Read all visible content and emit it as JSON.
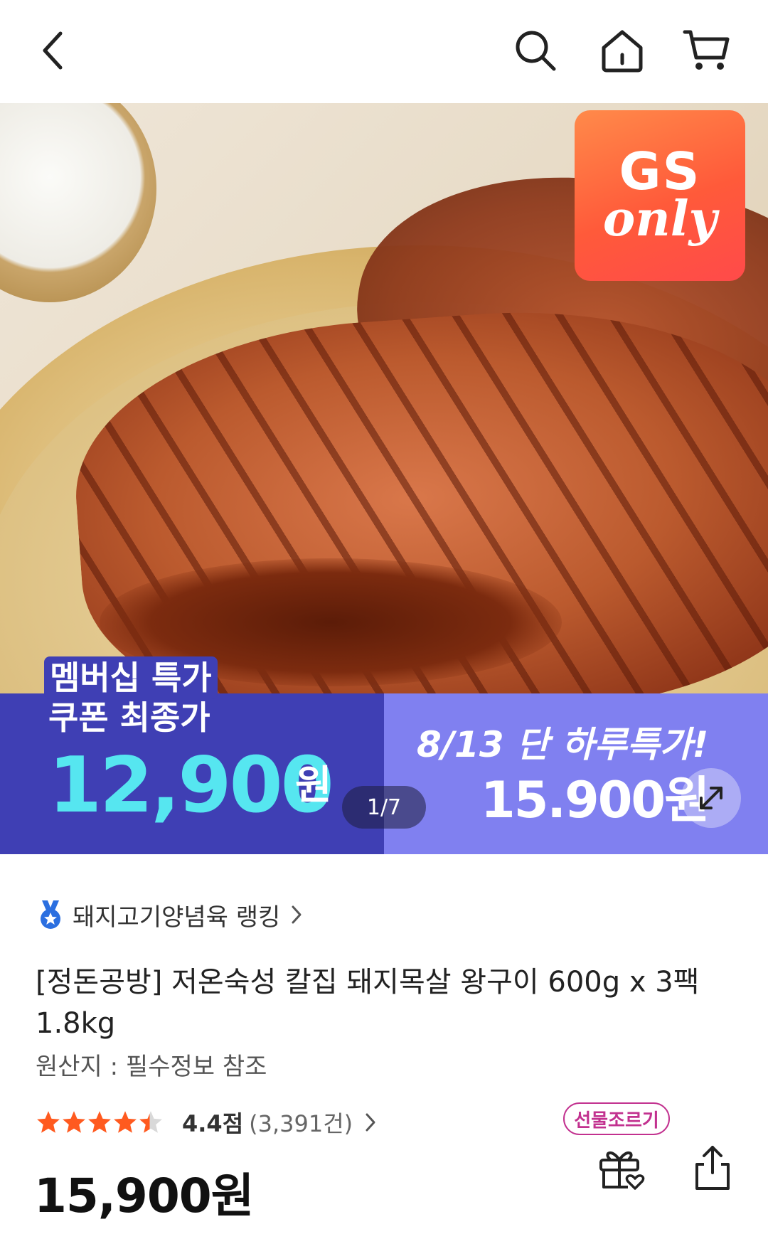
{
  "hero": {
    "badge_line1": "GS",
    "badge_line2": "only",
    "promo_tag": "멤버십 특가",
    "promo_line2": "쿠폰 최종가",
    "promo_price": "12,900",
    "promo_won": "원",
    "promo_date": "8/13 단 하루특가!",
    "promo_price2": "15.900원",
    "counter": "1/7"
  },
  "product": {
    "ranking": "돼지고기양념육 랭킹",
    "title": "[정돈공방] 저온숙성 칼집 돼지목살 왕구이 600g x 3팩 1.8kg",
    "origin": "원산지 : 필수정보 참조",
    "rating": 4.4,
    "rating_score": "4.4점",
    "rating_count": "(3,391건)",
    "price": "15,900원"
  },
  "actions": {
    "gift_label": "선물조르기"
  },
  "colors": {
    "promo_left": "#3f3fb4",
    "promo_right": "#8080f0",
    "promo_price": "#56e6f0",
    "star": "#ff5a1f",
    "gift_pink": "#c2318f",
    "badge": "#ff5a3a"
  },
  "icons": [
    "chevron-left-icon",
    "search-icon",
    "home-icon",
    "cart-icon",
    "expand-icon",
    "medal-icon",
    "chevron-right-icon",
    "star-icon",
    "gift-icon",
    "share-icon"
  ]
}
